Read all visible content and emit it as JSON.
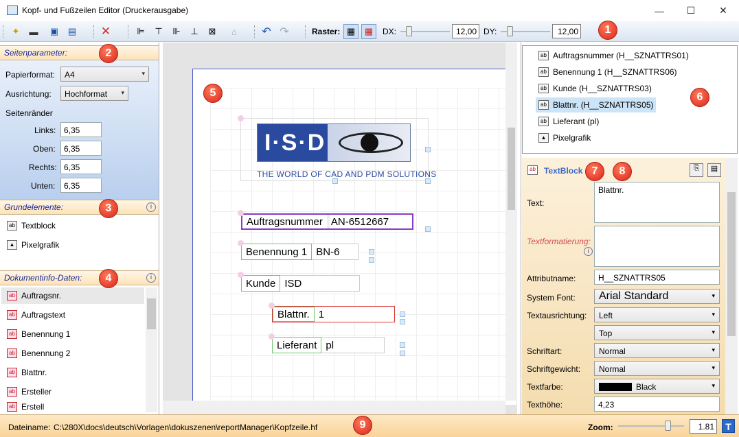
{
  "window": {
    "title": "Kopf- und Fußzeilen Editor (Druckerausgabe)",
    "minimize": "—",
    "maximize": "☐",
    "close": "✕"
  },
  "toolbar": {
    "raster_label": "Raster:",
    "dx_label": "DX:",
    "dx_value": "12,00",
    "dy_label": "DY:",
    "dy_value": "12,00"
  },
  "badges": [
    "1",
    "2",
    "3",
    "4",
    "5",
    "6",
    "7",
    "8",
    "9"
  ],
  "page_params": {
    "header": "Seitenparameter:",
    "paper_label": "Papierformat:",
    "paper_value": "A4",
    "orient_label": "Ausrichtung:",
    "orient_value": "Hochformat",
    "margins_label": "Seitenränder",
    "left_label": "Links:",
    "left_value": "6,35",
    "top_label": "Oben:",
    "top_value": "6,35",
    "right_label": "Rechts:",
    "right_value": "6,35",
    "bottom_label": "Unten:",
    "bottom_value": "6,35"
  },
  "basic_elements": {
    "header": "Grundelemente:",
    "items": [
      "Textblock",
      "Pixelgrafik"
    ]
  },
  "doc_info": {
    "header": "Dokumentinfo-Daten:",
    "items": [
      "Auftragsnr.",
      "Auftragstext",
      "Benennung 1",
      "Benennung 2",
      "Blattnr.",
      "Ersteller",
      "Erstell"
    ]
  },
  "canvas": {
    "logo_text": "I·S·D",
    "logo_tagline": "THE WORLD OF CAD AND PDM SOLUTIONS",
    "fields": [
      {
        "label": "Auftragsnummer",
        "value": "AN-6512667"
      },
      {
        "label": "Benennung 1",
        "value": "BN-6"
      },
      {
        "label": "Kunde",
        "value": "ISD"
      },
      {
        "label": "Blattnr.",
        "value": "1"
      },
      {
        "label": "Lieferant",
        "value": "pl"
      }
    ]
  },
  "tree": {
    "items": [
      "Auftragsnummer (H__SZNATTRS01)",
      "Benennung 1 (H__SZNATTRS06)",
      "Kunde (H__SZNATTRS03)",
      "Blattnr. (H__SZNATTRS05)",
      "Lieferant (pl)",
      "Pixelgrafik"
    ]
  },
  "props": {
    "header": "TextBlock",
    "text_label": "Text:",
    "text_value": "Blattnr.",
    "format_label": "Textformatierung:",
    "attr_label": "Attributname:",
    "attr_value": "H__SZNATTRS05",
    "font_label": "System Font:",
    "font_value": "Arial Standard",
    "align_label": "Textausrichtung:",
    "align_h": "Left",
    "align_v": "Top",
    "style_label": "Schriftart:",
    "style_value": "Normal",
    "weight_label": "Schriftgewicht:",
    "weight_value": "Normal",
    "color_label": "Textfarbe:",
    "color_value": "Black",
    "height_label": "Texthöhe:",
    "height_value": "4,23"
  },
  "status": {
    "file_label": "Dateiname:",
    "file_path": "C:\\280X\\docs\\deutsch\\Vorlagen\\dokuszenen\\reportManager\\Kopfzeile.hf",
    "zoom_label": "Zoom:",
    "zoom_value": "1.81"
  },
  "colors": {
    "badge": "#d8261a",
    "section_text": "#1a2a9a",
    "logo_blue": "#2a4aa0"
  }
}
